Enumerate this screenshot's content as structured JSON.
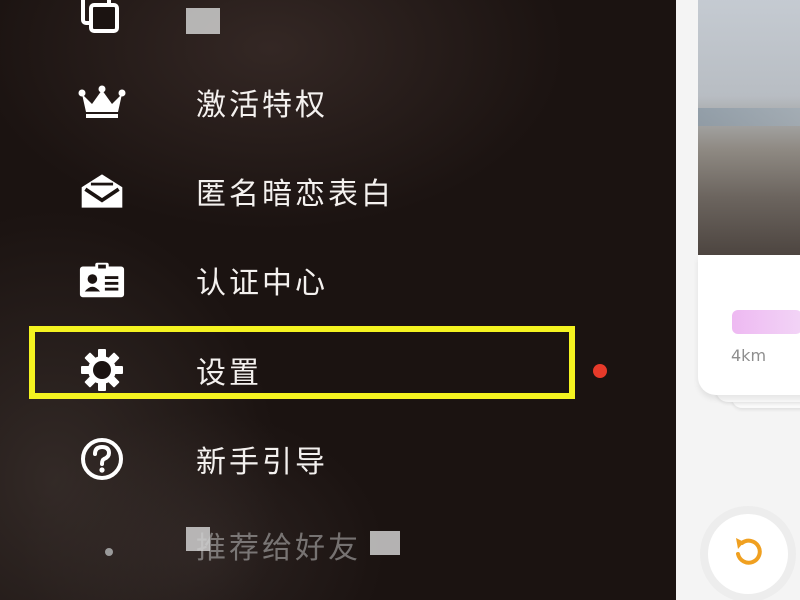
{
  "drawer": {
    "items": [
      {
        "label": "",
        "icon": "copy-icon"
      },
      {
        "label": "激活特权",
        "icon": "crown-icon"
      },
      {
        "label": "匿名暗恋表白",
        "icon": "envelope-icon"
      },
      {
        "label": "认证中心",
        "icon": "id-card-icon"
      },
      {
        "label": "设置",
        "icon": "gear-icon"
      },
      {
        "label": "新手引导",
        "icon": "help-circle-icon"
      },
      {
        "label": "推荐给好友",
        "icon": "share-icon"
      }
    ],
    "highlight_color": "#f4f320",
    "notification_dot_color": "#e63a2a"
  },
  "card": {
    "distance": "4km"
  },
  "colors": {
    "drawer_bg": "#1b1311",
    "text": "#f4f1ef",
    "accent": "#f0a020"
  }
}
